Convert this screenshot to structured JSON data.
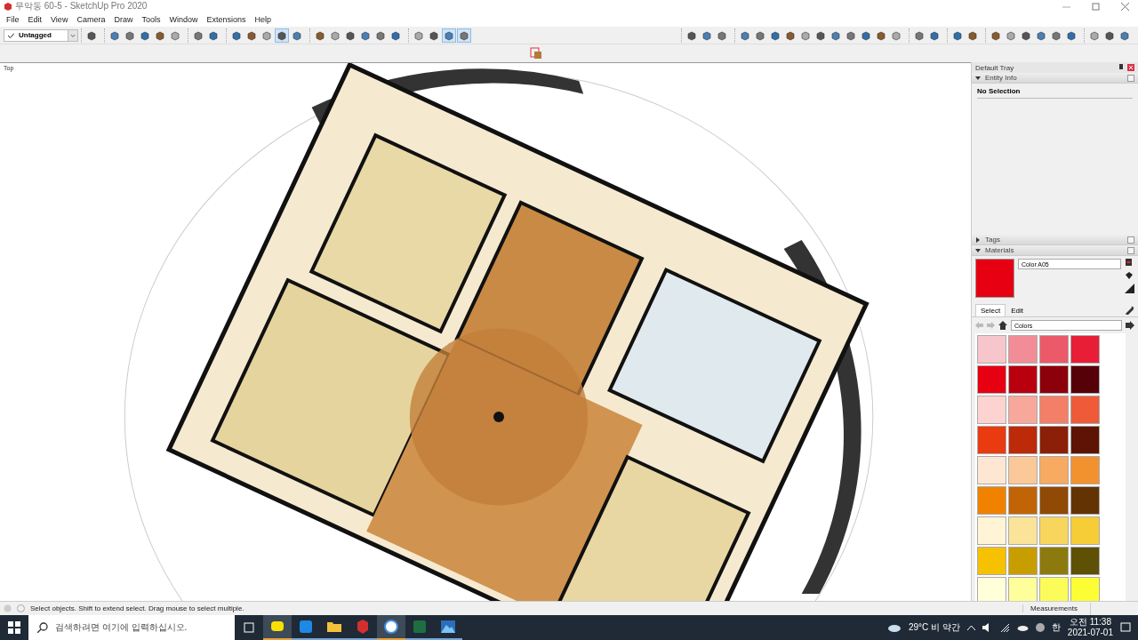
{
  "window": {
    "title": "무악동 60-5 - SketchUp Pro 2020"
  },
  "menu": [
    "File",
    "Edit",
    "View",
    "Camera",
    "Draw",
    "Tools",
    "Window",
    "Extensions",
    "Help"
  ],
  "tag_dropdown": {
    "value": "Untagged",
    "checked": true
  },
  "toolbar_left": [
    [
      {
        "selected": false
      }
    ],
    [
      {
        "selected": false
      },
      {
        "selected": false
      },
      {
        "selected": false
      },
      {
        "selected": false
      },
      {
        "selected": false
      }
    ],
    [
      {
        "selected": false
      },
      {
        "selected": false
      }
    ],
    [
      {
        "selected": false
      },
      {
        "selected": false
      },
      {
        "selected": false
      },
      {
        "selected": true
      },
      {
        "selected": false
      }
    ],
    [
      {
        "selected": false
      },
      {
        "selected": false
      },
      {
        "selected": false
      },
      {
        "selected": false
      },
      {
        "selected": false
      },
      {
        "selected": false
      }
    ],
    [
      {
        "selected": false
      },
      {
        "selected": false
      },
      {
        "selected": true
      },
      {
        "selected": true
      }
    ]
  ],
  "toolbar_right": [
    [
      {
        "selected": false
      },
      {
        "selected": false
      },
      {
        "selected": false
      }
    ],
    [
      {
        "selected": false
      },
      {
        "selected": false
      },
      {
        "selected": false
      },
      {
        "selected": false
      },
      {
        "selected": false
      },
      {
        "selected": false
      },
      {
        "selected": false
      },
      {
        "selected": false
      },
      {
        "selected": false
      },
      {
        "selected": false
      },
      {
        "selected": false
      }
    ],
    [
      {
        "selected": false
      },
      {
        "selected": false
      }
    ],
    [
      {
        "selected": false
      },
      {
        "selected": false
      }
    ],
    [
      {
        "selected": false
      },
      {
        "selected": false
      },
      {
        "selected": false
      },
      {
        "selected": false
      },
      {
        "selected": false
      },
      {
        "selected": false
      }
    ],
    [
      {
        "selected": false
      },
      {
        "selected": false
      },
      {
        "selected": false
      }
    ]
  ],
  "viewport": {
    "view_label": "Top"
  },
  "tray": {
    "title": "Default Tray",
    "panels": [
      {
        "title": "Entity Info",
        "expanded": true,
        "kind": "entity",
        "text": "No Selection"
      },
      {
        "title": "Tags",
        "expanded": false
      },
      {
        "title": "Materials",
        "expanded": true,
        "kind": "materials",
        "material_name": "Color A05",
        "tabs": [
          {
            "label": "Select",
            "selected": true
          },
          {
            "label": "Edit",
            "selected": false
          }
        ],
        "library": "Colors",
        "swatches": [
          {
            "color": "#f7c6cc"
          },
          {
            "color": "#f28d97"
          },
          {
            "color": "#ec5a69"
          },
          {
            "color": "#e81e36"
          },
          {
            "color": "#e60012"
          },
          {
            "color": "#b8000f"
          },
          {
            "color": "#8c000b"
          },
          {
            "color": "#560008"
          },
          {
            "color": "#fcd3d0"
          },
          {
            "color": "#f7a89a"
          },
          {
            "color": "#f27f66"
          },
          {
            "color": "#ef5a38"
          },
          {
            "color": "#ea3a10"
          },
          {
            "color": "#bc2a0a"
          },
          {
            "color": "#8c1f08"
          },
          {
            "color": "#5e1404"
          },
          {
            "color": "#fde7d2"
          },
          {
            "color": "#fac899"
          },
          {
            "color": "#f6aa62"
          },
          {
            "color": "#f2922f"
          },
          {
            "color": "#f08200"
          },
          {
            "color": "#c16406"
          },
          {
            "color": "#904a05"
          },
          {
            "color": "#643303"
          },
          {
            "color": "#fff4d6"
          },
          {
            "color": "#fbe499"
          },
          {
            "color": "#f8d65e"
          },
          {
            "color": "#f7cd37"
          },
          {
            "color": "#f6c100"
          },
          {
            "color": "#c89d00"
          },
          {
            "color": "#8c7a0f"
          },
          {
            "color": "#5e5005"
          },
          {
            "color": "#ffffd9"
          },
          {
            "color": "#fefe9a"
          },
          {
            "color": "#fbfc59"
          },
          {
            "color": "#fdfd36"
          }
        ]
      }
    ]
  },
  "status_bar": {
    "message": "Select objects. Shift to extend select. Drag mouse to select multiple.",
    "measurements_label": "Measurements"
  },
  "taskbar": {
    "search": {
      "placeholder": "검색하려면 여기에 입력하십시오."
    },
    "apps": [
      {
        "kind": "chat",
        "selected": true
      },
      {
        "kind": "tool",
        "selected": false
      },
      {
        "kind": "folder",
        "selected": false
      },
      {
        "kind": "sketch",
        "selected": false
      },
      {
        "kind": "camera",
        "selected": true
      },
      {
        "kind": "excel",
        "selected": false
      },
      {
        "kind": "photos",
        "selected": false
      }
    ],
    "weather": "29°C 비 약간",
    "ime": "한",
    "time": "오전 11:38",
    "date": "2021-07-01"
  }
}
